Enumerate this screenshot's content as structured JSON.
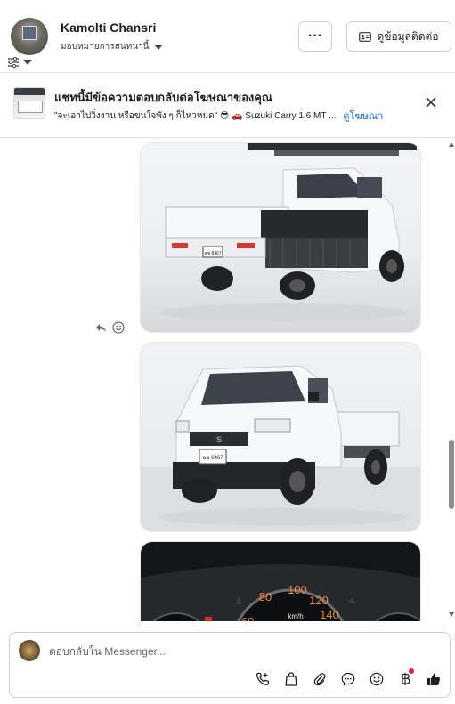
{
  "header": {
    "contact_name": "Kamolti Chansri",
    "assign_label": "มอบหมายการสนทนานี้",
    "more_label": "···",
    "contact_info_label": "ดูข้อมูลติดต่อ"
  },
  "ad_banner": {
    "title": "แชทนี้มีข้อความตอบกลับต่อโฆษณาของคุณ",
    "quote": "\"จะเอาไปวิ่งงาน หรือขนใจพัง ๆ ก็ไหวหมด\" 😎 🚗 Suzuki Carry 1.6 MT ...",
    "view_ad_link": "ดูโฆษณา"
  },
  "thread": {
    "images": [
      {
        "alt": "White Suzuki Carry pickup rear three-quarter view in showroom",
        "plate": "ฉช 8467"
      },
      {
        "alt": "White Suzuki Carry pickup front three-quarter view in showroom",
        "plate": "ฉช 8467"
      },
      {
        "alt": "Instrument cluster speedometer",
        "gauge_ticks": [
          "60",
          "80",
          "100",
          "120",
          "140"
        ],
        "gauge_unit": "km/h"
      }
    ]
  },
  "composer": {
    "placeholder": "ตอบกลับใน Messenger..."
  },
  "icons": {
    "filter": "sliders-icon",
    "contact": "contact-card-icon",
    "close": "close-icon",
    "reply": "reply-icon",
    "react": "smiley-icon",
    "call": "phone-add-icon",
    "shop": "shopping-bag-icon",
    "attach": "paperclip-icon",
    "saved_reply": "chat-bubble-icon",
    "emoji": "emoji-icon",
    "payment": "baht-icon",
    "like": "thumbs-up-icon"
  },
  "colors": {
    "link_blue": "#0866ff",
    "notification_red": "#e41e3f"
  }
}
